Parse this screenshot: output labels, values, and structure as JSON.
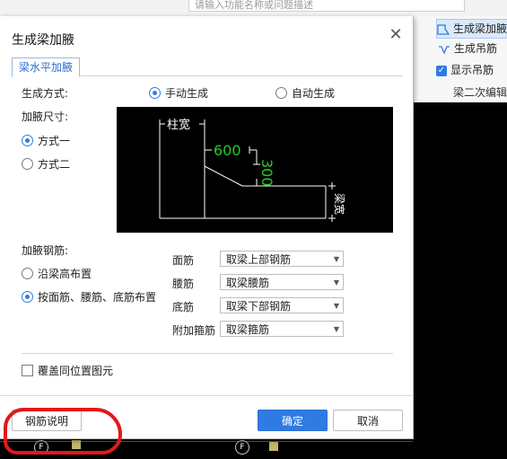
{
  "app": {
    "search_placeholder": "请输入功能名称或问题描述",
    "ribbon": {
      "items": [
        {
          "label": "生成梁加腋",
          "icon": "beam-haunch-icon"
        },
        {
          "label": "生成吊筋",
          "icon": "hanger-rebar-icon"
        },
        {
          "label": "显示吊筋",
          "icon": "checkbox-icon",
          "checked": true
        }
      ],
      "group_label": "梁二次编辑"
    }
  },
  "dialog": {
    "title": "生成梁加腋",
    "tab": "梁水平加腋",
    "generate_mode": {
      "label": "生成方式:",
      "options": [
        {
          "label": "手动生成",
          "selected": true
        },
        {
          "label": "自动生成",
          "selected": false
        }
      ]
    },
    "haunch_size": {
      "label": "加腋尺寸:",
      "options": [
        {
          "label": "方式一",
          "selected": true
        },
        {
          "label": "方式二",
          "selected": false
        }
      ]
    },
    "diagram": {
      "col_width_label": "柱宽",
      "horizontal_dim": "600",
      "vertical_dim": "300",
      "beam_width_label": "梁宽"
    },
    "haunch_rebar": {
      "label": "加腋钢筋:",
      "options": [
        {
          "label": "沿梁高布置",
          "selected": false
        },
        {
          "label": "按面筋、腰筋、底筋布置",
          "selected": true
        }
      ],
      "fields": [
        {
          "label": "面筋",
          "value": "取梁上部钢筋"
        },
        {
          "label": "腰筋",
          "value": "取梁腰筋"
        },
        {
          "label": "底筋",
          "value": "取梁下部钢筋"
        },
        {
          "label": "附加箍筋",
          "value": "取梁箍筋"
        }
      ]
    },
    "overwrite_checkbox": {
      "label": "覆盖同位置图元",
      "checked": false
    },
    "buttons": {
      "rebar_help": "钢筋说明",
      "ok": "确定",
      "cancel": "取消"
    }
  },
  "colors": {
    "accent": "#2f7be3",
    "diagram_dim": "#22cc22",
    "annotation_red": "#e01919"
  }
}
